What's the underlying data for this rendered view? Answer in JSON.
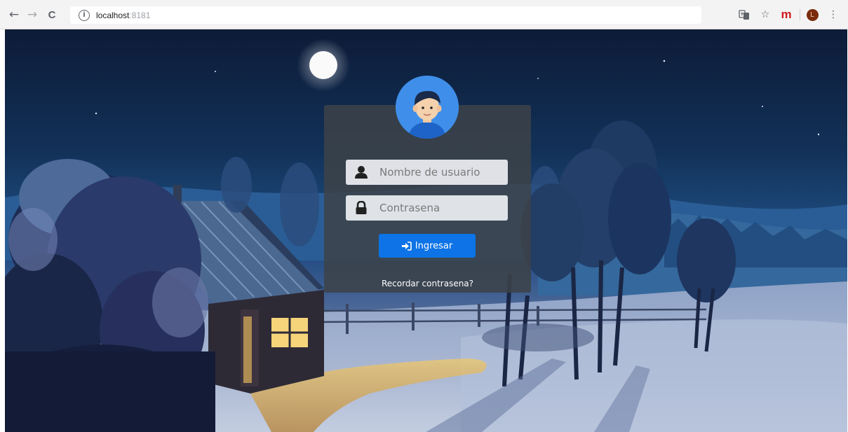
{
  "browser": {
    "url_host": "localhost",
    "url_port": ":8181",
    "back_glyph": "←",
    "forward_glyph": "→",
    "reload_glyph": "C",
    "info_glyph": "i",
    "star_glyph": "☆",
    "menu_glyph": "⋮",
    "extension_label": "m",
    "profile_initial": "L"
  },
  "login": {
    "username_placeholder": "Nombre de usuario",
    "password_placeholder": "Contrasena",
    "submit_label": "Ingresar",
    "forgot_label": "Recordar contrasena?"
  },
  "colors": {
    "primary_button": "#0d73e6",
    "card_background": "#3c4248",
    "avatar_background": "#3f8fea"
  },
  "icons": {
    "user": "user-icon",
    "lock": "lock-icon",
    "sign_in": "sign-in-icon",
    "avatar": "avatar-icon"
  }
}
